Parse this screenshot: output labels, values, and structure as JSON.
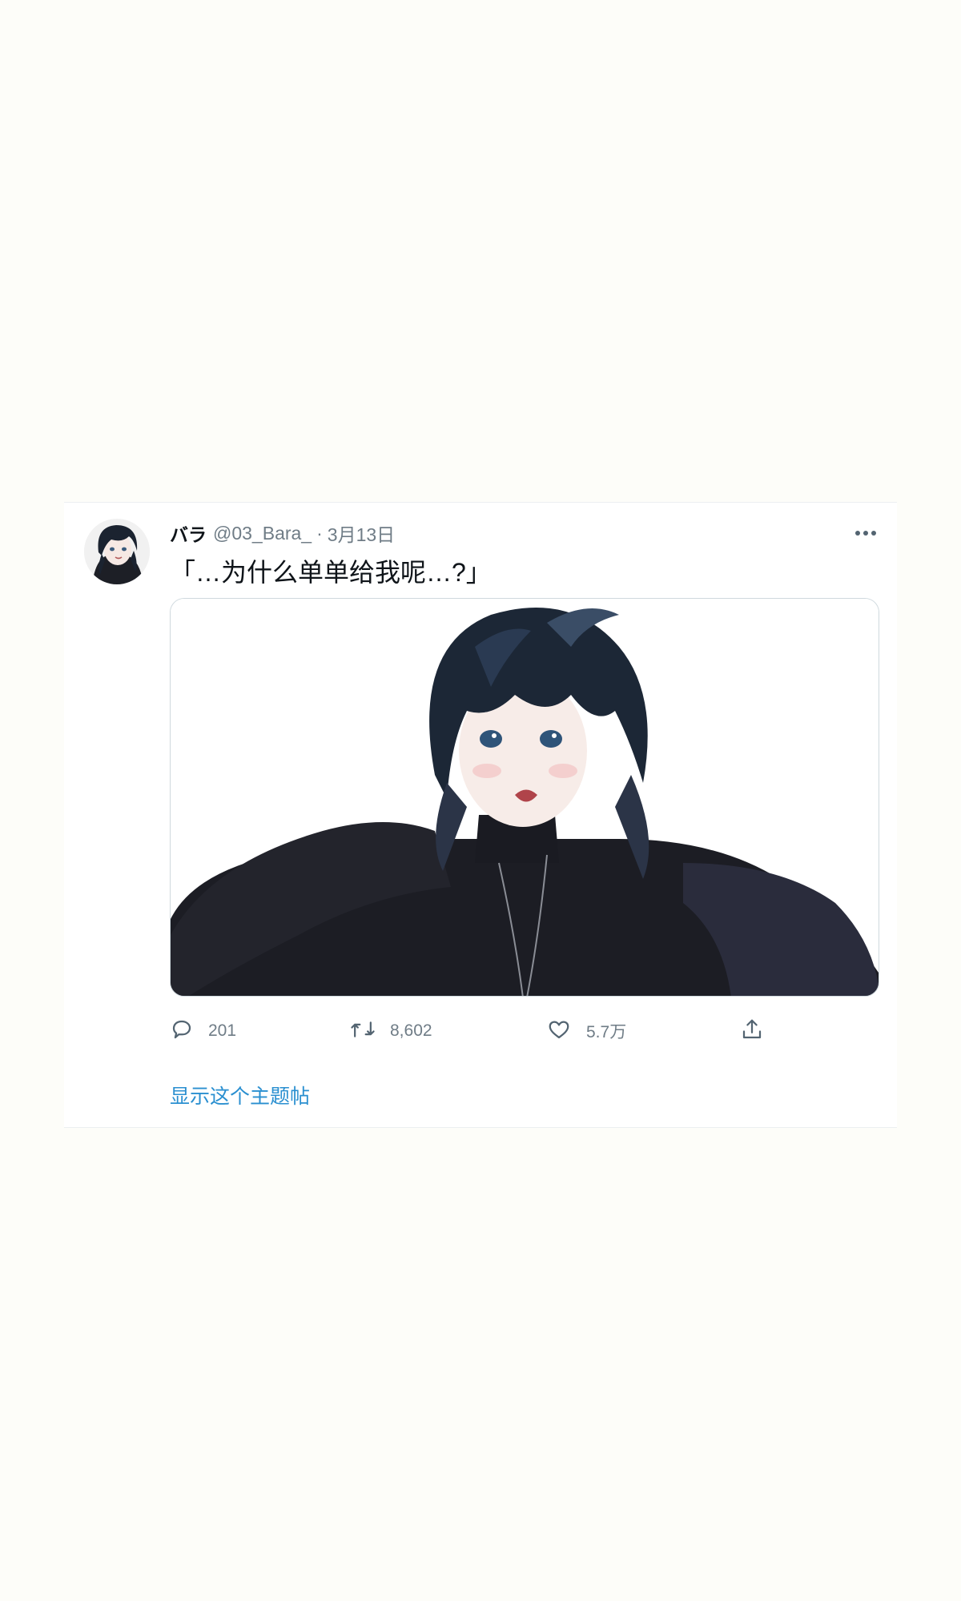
{
  "tweet": {
    "display_name": "バラ",
    "handle": "@03_Bara_",
    "separator": "·",
    "date": "3月13日",
    "text": "「…为什么单单给我呢…?」",
    "more_icon": "more-horizontal-icon",
    "media_description": "anime-illustration-dark-haired-character",
    "actions": {
      "reply": {
        "icon": "reply-bubble-icon",
        "count": "201"
      },
      "retweet": {
        "icon": "retweet-icon",
        "count": "8,602"
      },
      "like": {
        "icon": "heart-icon",
        "count": "5.7万"
      },
      "share": {
        "icon": "share-icon",
        "count": ""
      }
    },
    "thread_link": "显示这个主题帖"
  },
  "colors": {
    "page_background": "#fdfdf9",
    "card_background": "#ffffff",
    "primary_text": "#0f1419",
    "secondary_text": "#6f7c86",
    "link": "#2a8fd0",
    "border": "#cfd9de"
  }
}
